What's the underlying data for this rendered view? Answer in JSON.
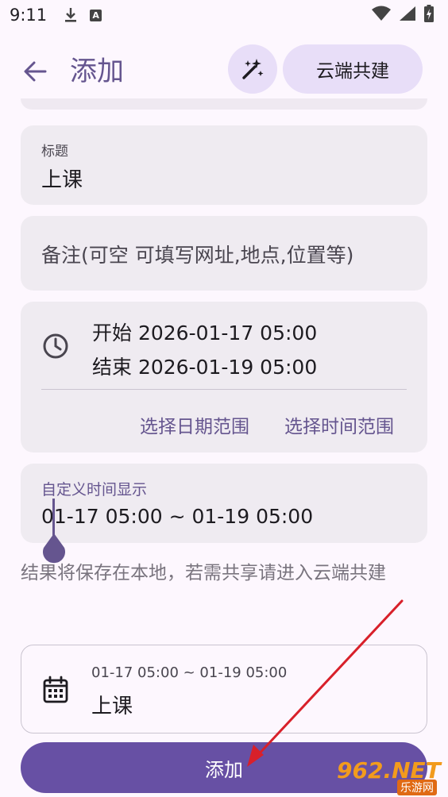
{
  "status_bar": {
    "time": "9:11",
    "icons": [
      "download-icon",
      "a-badge-icon",
      "wifi-icon",
      "signal-icon",
      "battery-icon"
    ],
    "badge_letter": "A"
  },
  "app_bar": {
    "title": "添加",
    "cloud_button_label": "云端共建"
  },
  "form": {
    "title_label": "标题",
    "title_value": "上课",
    "note_placeholder": "备注(可空 可填写网址,地点,位置等)",
    "start_text": "开始 2026-01-17 05:00",
    "end_text": "结束 2026-01-19 05:00",
    "select_date_range": "选择日期范围",
    "select_time_range": "选择时间范围",
    "custom_time_label": "自定义时间显示",
    "custom_time_value": "01-17 05:00 ~ 01-19 05:00"
  },
  "hint": "结果将保存在本地，若需共享请进入云端共建",
  "preview": {
    "time": "01-17 05:00 ~ 01-19 05:00",
    "title": "上课"
  },
  "add_button_label": "添加",
  "watermark": {
    "logo": "962.NET",
    "sub": "乐游网"
  },
  "colors": {
    "primary": "#6750a4",
    "primary_text": "#65558f",
    "tonal": "#e8def8",
    "card": "#efebf1",
    "arrow": "#d8202a"
  }
}
